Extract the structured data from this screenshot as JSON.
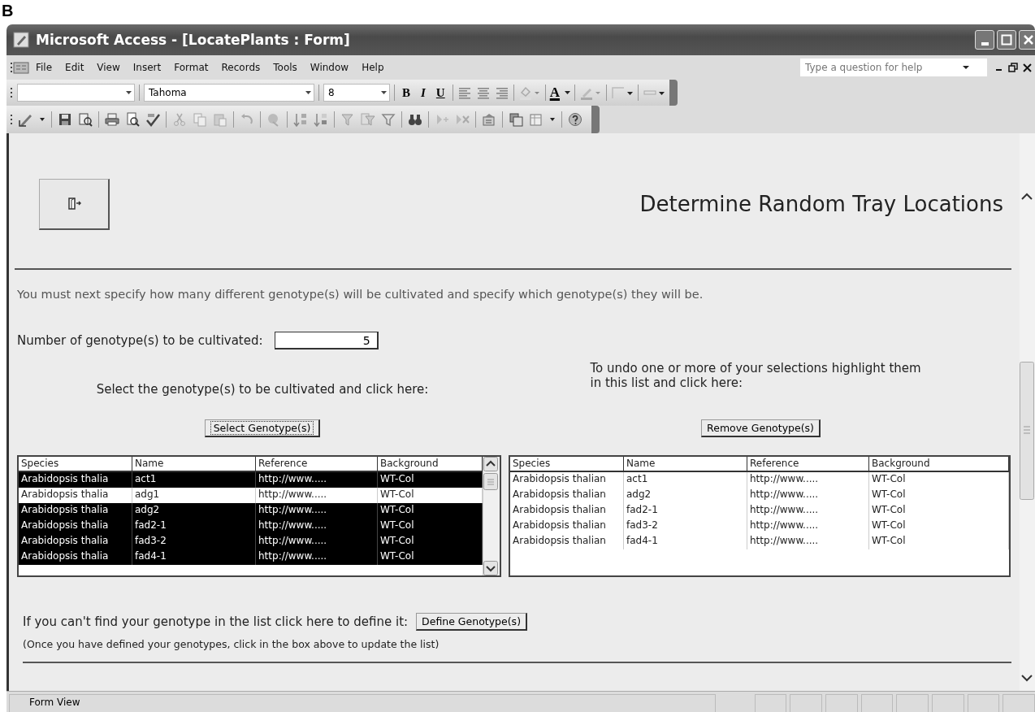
{
  "figure_label": "B",
  "window": {
    "title": "Microsoft Access - [LocatePlants : Form]"
  },
  "menu": [
    "File",
    "Edit",
    "View",
    "Insert",
    "Format",
    "Records",
    "Tools",
    "Window",
    "Help"
  ],
  "help_box": {
    "placeholder": "Type a question for help"
  },
  "format_toolbar": {
    "font": "Tahoma",
    "size": "8",
    "bold": "B",
    "italic": "I",
    "underline": "U",
    "font_color": "A"
  },
  "form": {
    "heading": "Determine Random Tray Locations",
    "instruction": "You must next specify how many different genotype(s) will be cultivated and specify which genotype(s) they will be.",
    "count_label": "Number of genotype(s) to be cultivated:",
    "count_value": "5",
    "select_hint": "Select the genotype(s) to be cultivated and click here:",
    "remove_hint": "To undo one or more of your selections highlight them in this list and click here:",
    "select_button": "Select Genotype(s)",
    "remove_button": "Remove Genotype(s)",
    "available": {
      "columns": [
        "Species",
        "Name",
        "Reference",
        "Background"
      ],
      "rows": [
        {
          "cells": [
            "Arabidopsis thalia",
            "act1",
            "http://www.....",
            "WT-Col"
          ],
          "selected": true
        },
        {
          "cells": [
            "Arabidopsis thalia",
            "adg1",
            "http://www.....",
            "WT-Col"
          ],
          "selected": false
        },
        {
          "cells": [
            "Arabidopsis thalia",
            "adg2",
            "http://www.....",
            "WT-Col"
          ],
          "selected": true
        },
        {
          "cells": [
            "Arabidopsis thalia",
            "fad2-1",
            "http://www.....",
            "WT-Col"
          ],
          "selected": true
        },
        {
          "cells": [
            "Arabidopsis thalia",
            "fad3-2",
            "http://www.....",
            "WT-Col"
          ],
          "selected": true
        },
        {
          "cells": [
            "Arabidopsis thalia",
            "fad4-1",
            "http://www.....",
            "WT-Col"
          ],
          "selected": true
        }
      ]
    },
    "chosen": {
      "columns": [
        "Species",
        "Name",
        "Reference",
        "Background"
      ],
      "rows": [
        {
          "cells": [
            "Arabidopsis thalian",
            "act1",
            "http://www.....",
            "WT-Col"
          ]
        },
        {
          "cells": [
            "Arabidopsis thalian",
            "adg2",
            "http://www.....",
            "WT-Col"
          ]
        },
        {
          "cells": [
            "Arabidopsis thalian",
            "fad2-1",
            "http://www.....",
            "WT-Col"
          ]
        },
        {
          "cells": [
            "Arabidopsis thalian",
            "fad3-2",
            "http://www.....",
            "WT-Col"
          ]
        },
        {
          "cells": [
            "Arabidopsis thalian",
            "fad4-1",
            "http://www.....",
            "WT-Col"
          ]
        }
      ]
    },
    "define_prompt": "If you can't find your genotype in the list click here to define it:",
    "define_button": "Define Genotype(s)",
    "note": "(Once you have defined your genotypes, click in the box above to update the list)"
  },
  "status_bar": {
    "text": "Form View"
  }
}
